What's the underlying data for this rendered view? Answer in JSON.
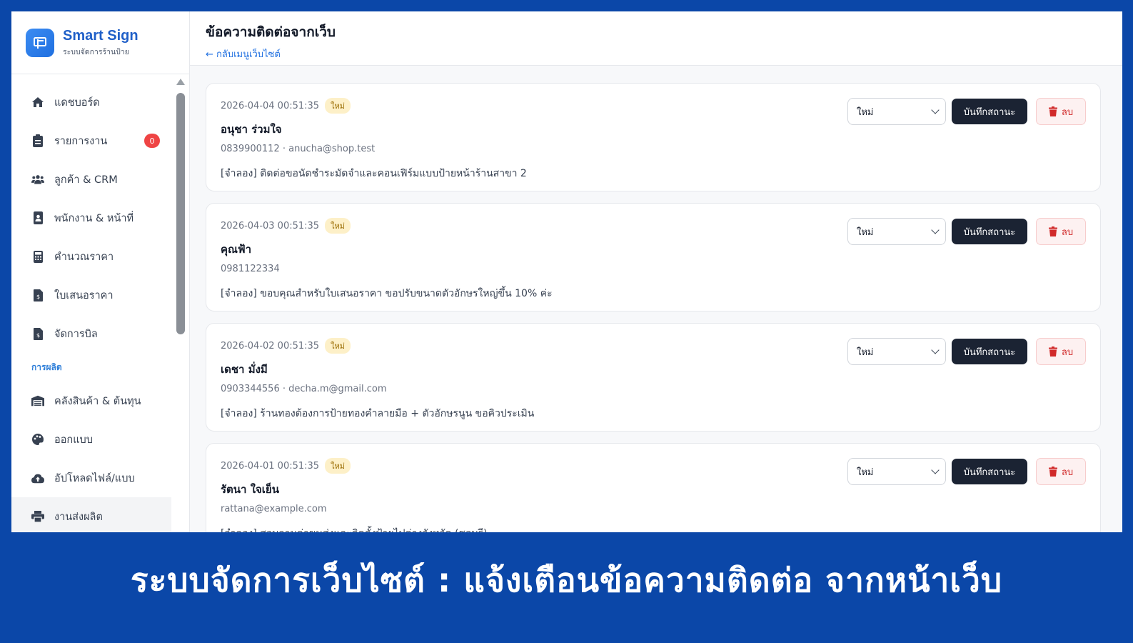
{
  "brand": {
    "name": "Smart Sign",
    "subtitle": "ระบบจัดการร้านป้าย"
  },
  "sidebar": {
    "items": [
      {
        "label": "แดชบอร์ด",
        "icon": "home-icon"
      },
      {
        "label": "รายการงาน",
        "icon": "clipboard-icon",
        "badge": "0"
      },
      {
        "label": "ลูกค้า & CRM",
        "icon": "users-icon"
      },
      {
        "label": "พนักงาน & หน้าที่",
        "icon": "id-badge-icon"
      },
      {
        "label": "คำนวณราคา",
        "icon": "calculator-icon"
      },
      {
        "label": "ใบเสนอราคา",
        "icon": "invoice-icon"
      },
      {
        "label": "จัดการบิล",
        "icon": "bill-icon"
      }
    ],
    "section_title": "การผลิต",
    "production_items": [
      {
        "label": "คลังสินค้า & ต้นทุน",
        "icon": "warehouse-icon"
      },
      {
        "label": "ออกแบบ",
        "icon": "palette-icon"
      },
      {
        "label": "อัปโหลดไฟล์/แบบ",
        "icon": "cloud-upload-icon"
      },
      {
        "label": "งานส่งผลิต",
        "icon": "printer-icon"
      }
    ]
  },
  "header": {
    "title": "ข้อความติดต่อจากเว็บ",
    "back_link": "← กลับเมนูเว็บไซต์"
  },
  "actions": {
    "status_value": "ใหม่",
    "save_label": "บันทึกสถานะ",
    "delete_label": "ลบ"
  },
  "messages": [
    {
      "date": "2026-04-04 00:51:35",
      "badge": "ใหม่",
      "name": "อนุชา ร่วมใจ",
      "contact": "0839900112 · anucha@shop.test",
      "text": "[จำลอง] ติดต่อขอนัดชำระมัดจำและคอนเฟิร์มแบบป้ายหน้าร้านสาขา 2"
    },
    {
      "date": "2026-04-03 00:51:35",
      "badge": "ใหม่",
      "name": "คุณฟ้า",
      "contact": "0981122334",
      "text": "[จำลอง] ขอบคุณสำหรับใบเสนอราคา ขอปรับขนาดตัวอักษรใหญ่ขึ้น 10% ค่ะ"
    },
    {
      "date": "2026-04-02 00:51:35",
      "badge": "ใหม่",
      "name": "เดชา มั่งมี",
      "contact": "0903344556 · decha.m@gmail.com",
      "text": "[จำลอง] ร้านทองต้องการป้ายทองคำลายมือ + ตัวอักษรนูน ขอคิวประเมิน"
    },
    {
      "date": "2026-04-01 00:51:35",
      "badge": "ใหม่",
      "name": "รัตนา ใจเย็น",
      "contact": "rattana@example.com",
      "text": "[จำลอง] สอบถามค่าขนส่งและติดตั้งป้ายไปต่างจังหวัด (ชลบุรี)"
    }
  ],
  "banner": {
    "text": "ระบบจัดการเว็บไซต์ : แจ้งเตือนข้อความติดต่อ จากหน้าเว็บ"
  },
  "colors": {
    "brand_blue": "#0b47a8",
    "accent": "#1f6fe0",
    "badge_red": "#ef4444",
    "new_pill": "#fdf0c8",
    "save_dark": "#1b2333"
  }
}
